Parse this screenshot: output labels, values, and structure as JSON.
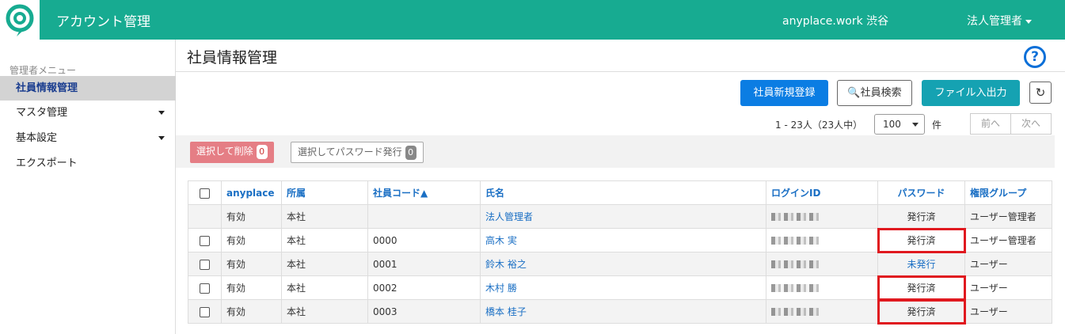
{
  "header": {
    "app_title": "アカウント管理",
    "tenant": "anyplace.work 渋谷",
    "user_menu": "法人管理者",
    "accent": "#17ab91"
  },
  "sidebar": {
    "heading": "管理者メニュー",
    "items": [
      {
        "label": "社員情報管理",
        "active": true
      },
      {
        "label": "マスタ管理",
        "dropdown": true
      },
      {
        "label": "基本設定",
        "dropdown": true
      },
      {
        "label": "エクスポート"
      }
    ]
  },
  "page": {
    "title": "社員情報管理",
    "help_icon": "question-circle-icon"
  },
  "toolbar": {
    "register": "社員新規登録",
    "search": "社員検索",
    "file_io": "ファイル入出力",
    "refresh_icon": "refresh-icon"
  },
  "paging": {
    "count_text": "1 - 23人（23人中）",
    "per_page": "100",
    "unit": "件",
    "prev": "前へ",
    "next": "次へ"
  },
  "actions": {
    "delete_label": "選択して削除",
    "delete_count": "0",
    "password_label": "選択してパスワード発行",
    "password_count": "0"
  },
  "table": {
    "headers": [
      "anyplace",
      "所属",
      "社員コード▲",
      "氏名",
      "ログインID",
      "パスワード",
      "権限グループ"
    ],
    "rows": [
      {
        "status": "有効",
        "dept": "本社",
        "code": "",
        "name": "法人管理者",
        "password": "発行済",
        "group": "ユーザー管理者",
        "checkbox": false
      },
      {
        "status": "有効",
        "dept": "本社",
        "code": "0000",
        "name": "高木 実",
        "password": "発行済",
        "group": "ユーザー管理者",
        "checkbox": true
      },
      {
        "status": "有効",
        "dept": "本社",
        "code": "0001",
        "name": "鈴木 裕之",
        "password": "未発行",
        "group": "ユーザー",
        "checkbox": true
      },
      {
        "status": "有効",
        "dept": "本社",
        "code": "0002",
        "name": "木村 勝",
        "password": "発行済",
        "group": "ユーザー",
        "checkbox": true
      },
      {
        "status": "有効",
        "dept": "本社",
        "code": "0003",
        "name": "橋本 桂子",
        "password": "発行済",
        "group": "ユーザー",
        "checkbox": true
      }
    ]
  }
}
